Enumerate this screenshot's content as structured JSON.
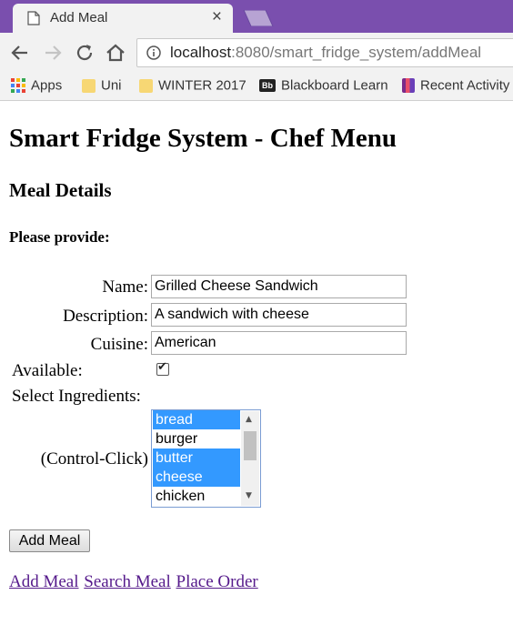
{
  "browser": {
    "tab_title": "Add Meal",
    "tab_close": "×",
    "url_host": "localhost",
    "url_path": ":8080/smart_fridge_system/addMeal",
    "bookmarks": [
      {
        "label": "Apps",
        "icon": "apps-grid-icon"
      },
      {
        "label": "Uni",
        "icon": "folder-icon"
      },
      {
        "label": "WINTER 2017",
        "icon": "folder-icon"
      },
      {
        "label": "Blackboard Learn",
        "icon": "blackboard-icon",
        "icon_text": "Bb"
      },
      {
        "label": "Recent Activity",
        "icon": "recent-activity-icon"
      }
    ]
  },
  "page": {
    "title": "Smart Fridge System - Chef Menu",
    "section": "Meal Details",
    "instructions": "Please provide:"
  },
  "form": {
    "name_label": "Name:",
    "name_value": "Grilled Cheese Sandwich",
    "description_label": "Description:",
    "description_value": "A sandwich with cheese",
    "cuisine_label": "Cuisine:",
    "cuisine_value": "American",
    "available_label": "Available:",
    "available_checked": true,
    "ingredients_label": "Select Ingredients:",
    "ingredients_hint": "(Control-Click)",
    "ingredients": [
      {
        "label": "bread",
        "selected": true
      },
      {
        "label": "burger",
        "selected": false
      },
      {
        "label": "butter",
        "selected": true
      },
      {
        "label": "cheese",
        "selected": true
      },
      {
        "label": "chicken",
        "selected": false
      }
    ],
    "submit_label": "Add Meal"
  },
  "links": [
    "Add Meal",
    "Search Meal",
    "Place Order"
  ],
  "colors": {
    "tabstrip": "#7a4fae",
    "selection": "#3399ff",
    "visited_link": "#551a8b"
  }
}
